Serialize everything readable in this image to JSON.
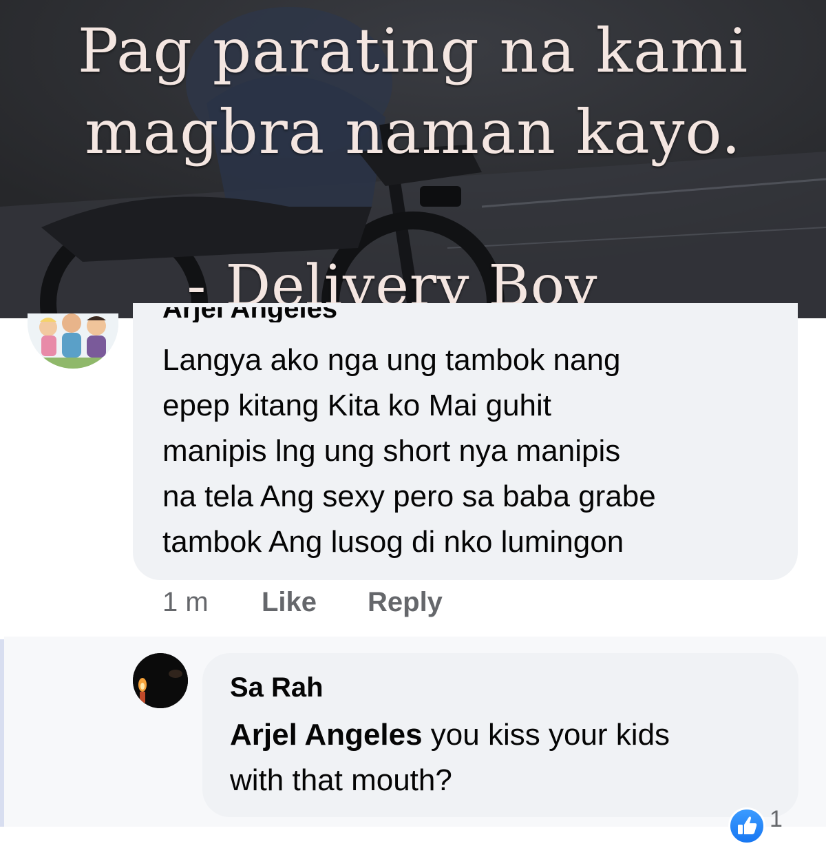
{
  "meme": {
    "line1": "Pag parating na kami",
    "line2": "magbra naman kayo.",
    "signature": "- Delivery Boy"
  },
  "comments": [
    {
      "author": "Arjel Angeles",
      "text_lines": [
        "Langya ako nga ung tambok nang",
        "epep kitang Kita ko Mai guhit",
        "manipis lng ung short nya manipis",
        "na tela Ang sexy pero sa baba grabe",
        "tambok Ang lusog di nko lumingon"
      ],
      "time": "1 m",
      "like_label": "Like",
      "reply_label": "Reply"
    }
  ],
  "reply": {
    "author": "Sa Rah",
    "mention": "Arjel Angeles",
    "text_after_mention": " you kiss your kids",
    "text_line2": "with that mouth?",
    "reaction_icon": "thumbs-up-icon",
    "reaction_count": "1"
  },
  "colors": {
    "bubble": "#f0f2f5",
    "meta_text": "#65676b",
    "reaction": "#1877f2"
  }
}
